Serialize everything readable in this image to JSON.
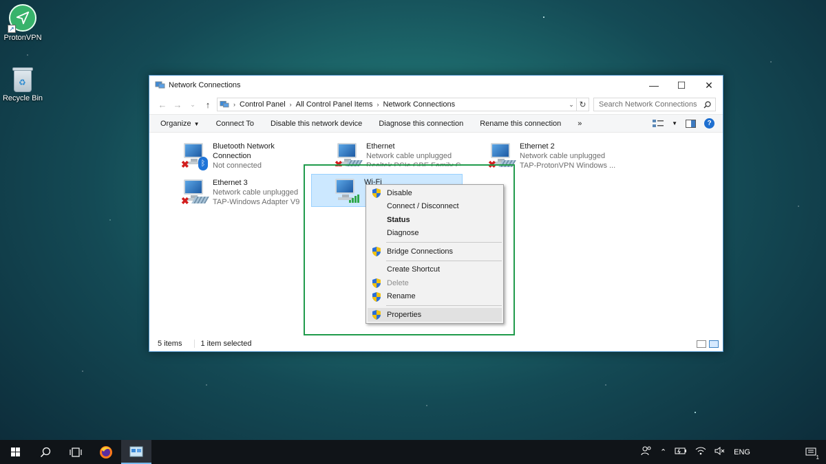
{
  "desktop": {
    "icons": [
      {
        "label": "ProtonVPN"
      },
      {
        "label": "Recycle Bin"
      }
    ]
  },
  "window": {
    "title": "Network Connections",
    "breadcrumbs": [
      "Control Panel",
      "All Control Panel Items",
      "Network Connections"
    ],
    "search_placeholder": "Search Network Connections",
    "commands": {
      "organize": "Organize",
      "connect_to": "Connect To",
      "disable": "Disable this network device",
      "diagnose": "Diagnose this connection",
      "rename": "Rename this connection",
      "more": "»"
    },
    "connections": [
      {
        "name": "Bluetooth Network",
        "name2": "Connection",
        "status": "Not connected",
        "adapter": "",
        "icon": "bluetooth-network-icon"
      },
      {
        "name": "Ethernet",
        "status": "Network cable unplugged",
        "adapter": "Realtek PCIe GBE Family C...",
        "icon": "ethernet-icon"
      },
      {
        "name": "Ethernet 2",
        "status": "Network cable unplugged",
        "adapter": "TAP-ProtonVPN Windows ...",
        "icon": "ethernet-icon"
      },
      {
        "name": "Ethernet 3",
        "status": "Network cable unplugged",
        "adapter": "TAP-Windows Adapter V9",
        "icon": "ethernet-icon"
      },
      {
        "name": "Wi-Fi",
        "status": "",
        "adapter": "",
        "icon": "wifi-network-icon",
        "selected": true
      }
    ],
    "status": {
      "items": "5 items",
      "selected": "1 item selected"
    }
  },
  "context_menu": {
    "items": [
      {
        "label": "Disable",
        "shield": true
      },
      {
        "label": "Connect / Disconnect",
        "shield": false
      },
      {
        "label": "Status",
        "shield": false,
        "bold": true
      },
      {
        "label": "Diagnose",
        "shield": false
      },
      {
        "label": "Bridge Connections",
        "shield": true
      },
      {
        "label": "Create Shortcut",
        "shield": false
      },
      {
        "label": "Delete",
        "shield": true,
        "disabled": true
      },
      {
        "label": "Rename",
        "shield": true
      },
      {
        "label": "Properties",
        "shield": true,
        "highlighted": true
      }
    ]
  },
  "taskbar": {
    "language": "ENG",
    "notification_count": "1"
  },
  "colors": {
    "highlight_box": "#1e9a4a",
    "selection": "#cce8ff",
    "accent": "#1e6fd0"
  }
}
